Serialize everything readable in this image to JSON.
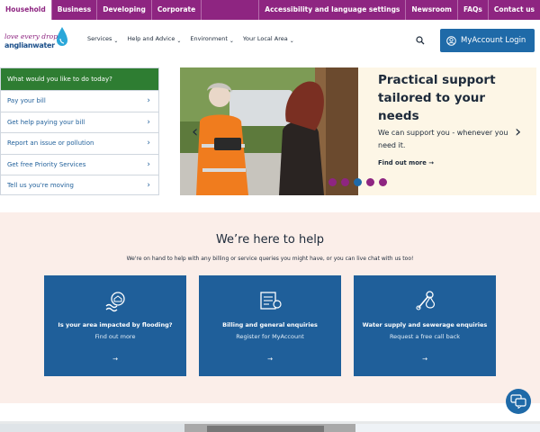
{
  "topbar": {
    "tabs": [
      "Household",
      "Business",
      "Developing",
      "Corporate"
    ],
    "right": [
      "Accessibility and language settings",
      "Newsroom",
      "FAQs",
      "Contact us"
    ]
  },
  "logo": {
    "line1": "love every drop",
    "line2": "anglianwater"
  },
  "nav": {
    "items": [
      "Services",
      "Help and Advice",
      "Environment",
      "Your Local Area"
    ],
    "myaccount_label": "MyAccount Login"
  },
  "quick_links": {
    "heading": "What would you like to do today?",
    "items": [
      "Pay your bill",
      "Get help paying your bill",
      "Report an issue or pollution",
      "Get free Priority Services",
      "Tell us you're moving"
    ]
  },
  "hero": {
    "title": "Practical support tailored to your needs",
    "subtitle": "We can support you - whenever you need it.",
    "link": "Find out more →",
    "slides": 5,
    "active_slide": 3
  },
  "help": {
    "title": "We’re here to help",
    "lead": "We're on hand to help with any billing or service queries you might have, or you can live chat with us too!",
    "cards": [
      {
        "title": "Is your area impacted by flooding?",
        "subtitle": "Find out more",
        "arrow": "→",
        "icon": "flood-icon"
      },
      {
        "title": "Billing and general enquiries",
        "subtitle": "Register for MyAccount",
        "arrow": "→",
        "icon": "billing-icon"
      },
      {
        "title": "Water supply and sewerage enquiries",
        "subtitle": "Request a free call back",
        "arrow": "→",
        "icon": "tools-icon"
      }
    ]
  },
  "colors": {
    "brand_purple": "#8e2581",
    "brand_blue": "#1f6aa8",
    "green": "#2e7d32"
  }
}
